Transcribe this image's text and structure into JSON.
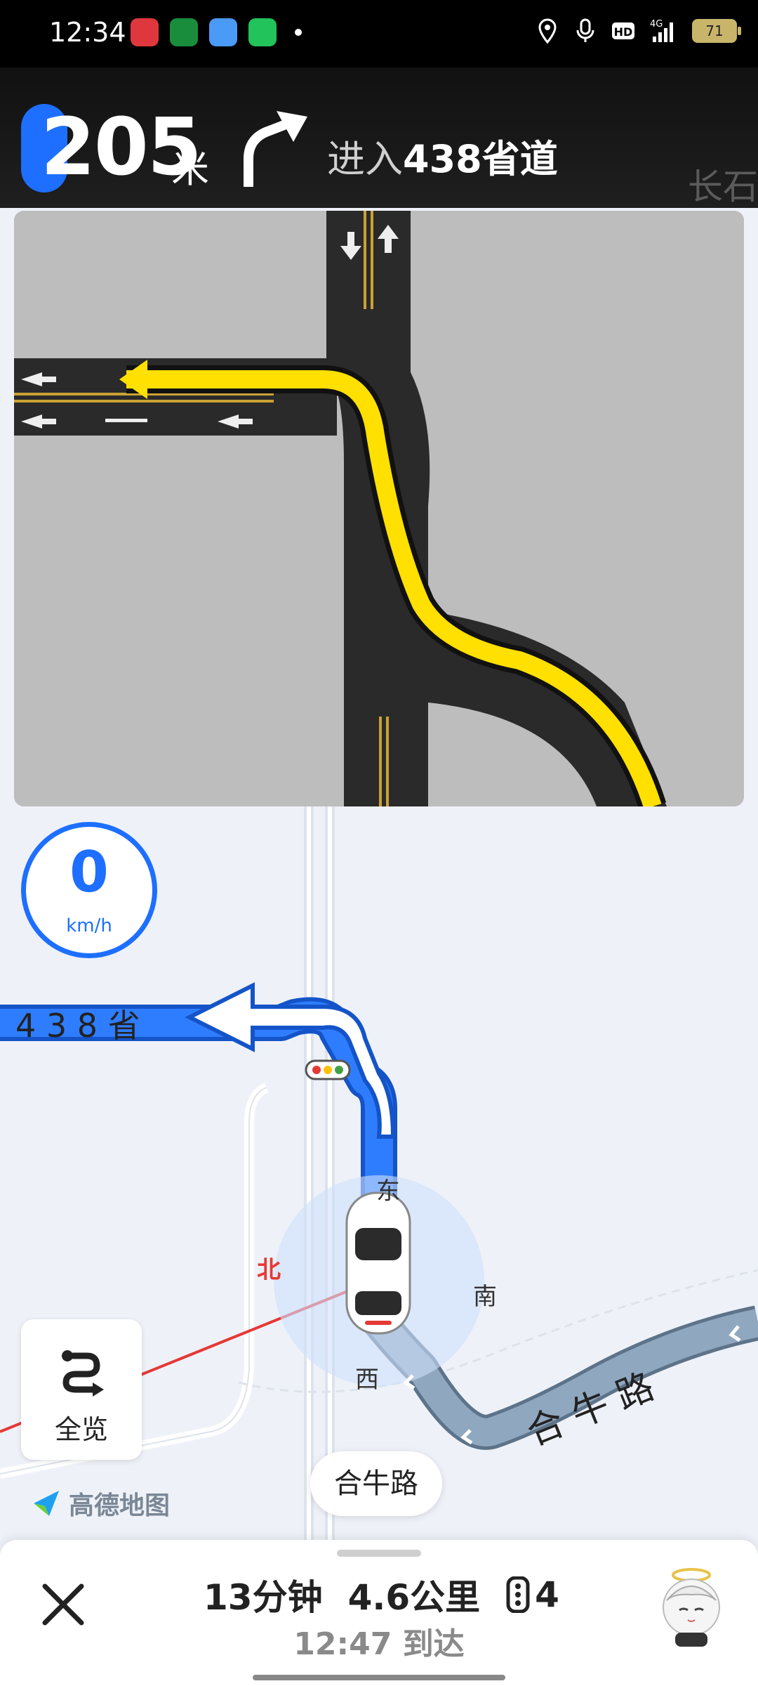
{
  "status_bar": {
    "time": "12:34",
    "battery": "71",
    "network": "4G",
    "hd": "HD"
  },
  "nav": {
    "distance_value": "205",
    "distance_unit": "米",
    "road_prefix": "进入",
    "road_name": "438省道",
    "road_peek": "长石"
  },
  "speed": {
    "value": "0",
    "unit": "km/h"
  },
  "map": {
    "road_label_left": "4 3 8 省",
    "road_label_right": "合 牛 路",
    "compass": {
      "east": "东",
      "south": "南",
      "west": "西",
      "north": "北"
    },
    "current_road": "合牛路"
  },
  "overview_button": {
    "label": "全览",
    "icon": "route-overview-icon"
  },
  "logo": {
    "text": "高德地图"
  },
  "trip": {
    "duration": "13分钟",
    "distance": "4.6公里",
    "traffic_lights": "4",
    "arrival": "12:47 到达"
  },
  "colors": {
    "accent": "#1e6fff",
    "route_yellow": "#ffe000",
    "north_red": "#e53935",
    "passed_route": "#8fa7bf"
  }
}
